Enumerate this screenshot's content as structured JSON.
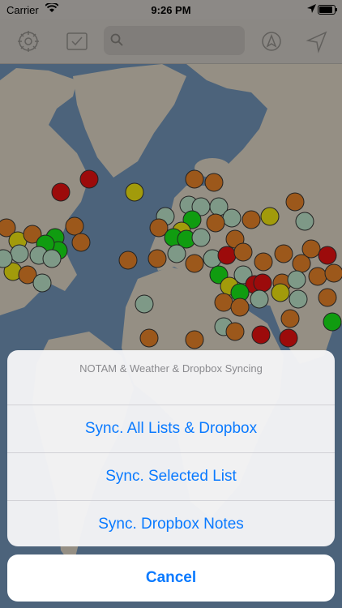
{
  "status_bar": {
    "carrier": "Carrier",
    "time": "9:26 PM",
    "icons": [
      "wifi-icon",
      "location-arrow-icon",
      "battery-icon"
    ]
  },
  "toolbar": {
    "icons": [
      "gear-icon",
      "checkbox-icon",
      "search-icon",
      "navigate-icon",
      "location-arrow-icon"
    ],
    "search_value": ""
  },
  "colors": {
    "land": "#d6cdbd",
    "ocean": "#6d8fb0",
    "red": "#e01010",
    "yellow": "#e8df10",
    "green": "#18e018",
    "orange": "#e07e28",
    "mint": "#b5dcc2",
    "accent": "#0a7aff"
  },
  "action_sheet": {
    "title": "NOTAM & Weather & Dropbox Syncing",
    "options": [
      "Sync. All Lists & Dropbox",
      "Sync. Selected List",
      "Sync. Dropbox Notes"
    ],
    "cancel": "Cancel"
  }
}
